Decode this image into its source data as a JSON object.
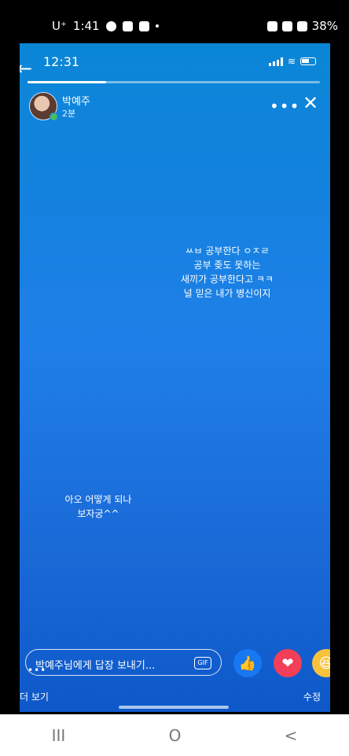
{
  "outer_status": {
    "carrier": "U⁺",
    "time": "1:41",
    "battery": "38%"
  },
  "inner_status": {
    "time": "12:31"
  },
  "story": {
    "progress": 0.27,
    "user_name": "박예주",
    "posted_time": "2분",
    "text_top": "ㅆㅂ 공부한다 ㅇㅈㄹ\n공부 좆도 못하는\n새끼가 공부한다고 ㅋㅋ\n널 믿은 내가 병신이지",
    "text_bottom": "아오 어떻게 되나\n보자궁^^"
  },
  "reply": {
    "placeholder": "박예주님에게 답장 보내기...",
    "gif_label": "GIF"
  },
  "reactions": [
    "like",
    "love",
    "haha"
  ],
  "footer": {
    "left": "더 보기",
    "right": "수정"
  },
  "nav": {
    "recent": "III",
    "home": "O",
    "back": "<"
  }
}
